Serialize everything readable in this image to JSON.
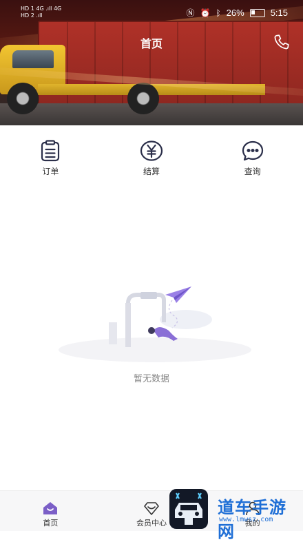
{
  "status_bar": {
    "left_line1": "HD 1  4G .ıll  4G",
    "left_line2": "HD 2  .ıll",
    "battery": "26%",
    "time": "5:15"
  },
  "header": {
    "title": "首页"
  },
  "actions": [
    {
      "label": "订单",
      "icon": "clipboard-icon"
    },
    {
      "label": "结算",
      "icon": "yen-icon"
    },
    {
      "label": "查询",
      "icon": "chat-bubble-icon"
    }
  ],
  "empty_state": {
    "text": "暂无数据"
  },
  "bottom_nav": [
    {
      "label": "首页",
      "icon": "home-icon",
      "active": true
    },
    {
      "label": "会员中心",
      "icon": "diamond-icon",
      "active": false
    },
    {
      "label": "我的",
      "icon": "user-icon",
      "active": false
    }
  ],
  "watermark": {
    "text": "道车手游网",
    "url": "www.lmwsz.com"
  },
  "colors": {
    "accent": "#7b5fc7",
    "icon_dark": "#2b2f4a"
  }
}
